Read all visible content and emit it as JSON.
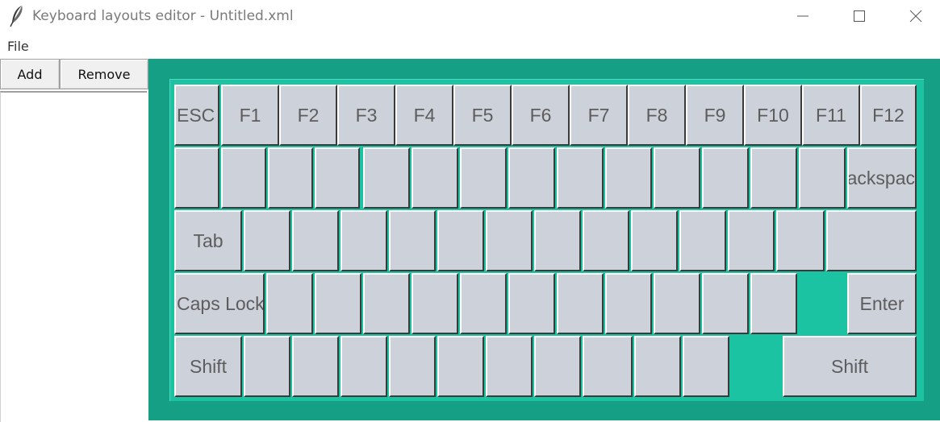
{
  "window": {
    "title": "Keyboard layouts editor - Untitled.xml",
    "icon": "feather-icon"
  },
  "menu": {
    "file_label": "File"
  },
  "toolbar": {
    "add_label": "Add",
    "remove_label": "Remove"
  },
  "layout_list": {
    "items": []
  },
  "colors": {
    "keyboard_frame": "#15a085",
    "keyboard_plate": "#1cc3a3",
    "key_face": "#cdd1da",
    "key_text": "#5d5d5d"
  },
  "keyboard": {
    "rows": [
      [
        "ESC",
        "F1",
        "F2",
        "F3",
        "F4",
        "F5",
        "F6",
        "F7",
        "F8",
        "F9",
        "F10",
        "F11",
        "F12"
      ],
      [
        "",
        "",
        "",
        "",
        "",
        "",
        "",
        "",
        "",
        "",
        "",
        "",
        "",
        "",
        "ackspac"
      ],
      [
        "Tab",
        "",
        "",
        "",
        "",
        "",
        "",
        "",
        "",
        "",
        "",
        "",
        "",
        ""
      ],
      [
        "Caps Lock",
        "",
        "",
        "",
        "",
        "",
        "",
        "",
        "",
        "",
        "",
        "",
        "Enter"
      ],
      [
        "Shift",
        "",
        "",
        "",
        "",
        "",
        "",
        "",
        "",
        "",
        "",
        "Shift"
      ]
    ]
  }
}
